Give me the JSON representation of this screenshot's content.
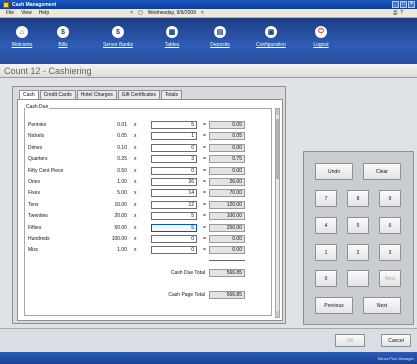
{
  "window": {
    "title": "Cash Management"
  },
  "menu": {
    "items": [
      "File",
      "View",
      "Help"
    ],
    "nav_prev": "<",
    "date": "Wednesday, 9/9/2009",
    "nav_next": "<",
    "status_icons": [
      "printer-icon",
      "help-icon"
    ]
  },
  "toolbar": {
    "buttons": [
      {
        "label": "Welcome",
        "icon": "home-icon"
      },
      {
        "label": "Bills",
        "icon": "bills-icon"
      },
      {
        "label": "Server Banks",
        "icon": "server-banks-icon"
      },
      {
        "label": "Tables",
        "icon": "tables-icon"
      },
      {
        "label": "Deposits",
        "icon": "deposits-icon"
      },
      {
        "label": "Configuration",
        "icon": "configuration-icon"
      },
      {
        "label": "Logout",
        "icon": "logout-icon"
      }
    ]
  },
  "header": {
    "title": "Count 12 - Cashiering"
  },
  "tabs": [
    "Cash",
    "Credit Cards",
    "Hotel Charges",
    "Gift Certificates",
    "Totals"
  ],
  "cash_due": {
    "label": "Cash Due",
    "x_symbol": "x",
    "eq_symbol": "=",
    "rows": [
      {
        "name": "Pennies",
        "value": "0.01",
        "qty": "5",
        "total": "0.05"
      },
      {
        "name": "Nickels",
        "value": "0.05",
        "qty": "1",
        "total": "0.05"
      },
      {
        "name": "Dimes",
        "value": "0.10",
        "qty": "0",
        "total": "0.00"
      },
      {
        "name": "Quarters",
        "value": "0.25",
        "qty": "3",
        "total": "0.75"
      },
      {
        "name": "Fifty Cent Piece",
        "value": "0.50",
        "qty": "0",
        "total": "0.00"
      },
      {
        "name": "Ones",
        "value": "1.00",
        "qty": "26",
        "total": "26.00"
      },
      {
        "name": "Fives",
        "value": "5.00",
        "qty": "14",
        "total": "70.00"
      },
      {
        "name": "Tens",
        "value": "10.00",
        "qty": "12",
        "total": "120.00"
      },
      {
        "name": "Twenties",
        "value": "20.00",
        "qty": "5",
        "total": "100.00"
      },
      {
        "name": "Fifties",
        "value": "50.00",
        "qty": "5",
        "total": "250.00"
      },
      {
        "name": "Hundreds",
        "value": "100.00",
        "qty": "0",
        "total": "0.00"
      },
      {
        "name": "Misc",
        "value": "1.00",
        "qty": "0",
        "total": "0.00"
      }
    ],
    "cash_due_total_label": "Cash Due Total",
    "cash_due_total": "566.85",
    "cash_page_total_label": "Cash Page Total",
    "cash_page_total": "566.85"
  },
  "keypad": {
    "undo": "Undo",
    "clear": "Clear",
    "digits": [
      "7",
      "8",
      "9",
      "4",
      "5",
      "6",
      "1",
      "2",
      "3",
      "0",
      ".",
      "Next"
    ],
    "previous": "Previous",
    "next": "Next"
  },
  "footer": {
    "ok": "OK",
    "cancel": "Cancel"
  },
  "statusbar": {
    "text": "Biena Plus Manager"
  }
}
